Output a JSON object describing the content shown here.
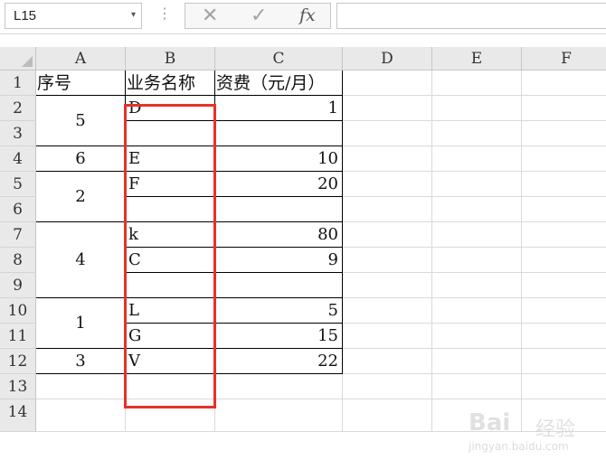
{
  "formula_bar": {
    "name_box": "L15",
    "name_box_arrow": "▾",
    "dots": "⋮",
    "cancel_icon": "✕",
    "enter_icon": "✓",
    "fx_label": "fx",
    "formula_value": ""
  },
  "columns": [
    "A",
    "B",
    "C",
    "D",
    "E",
    "F"
  ],
  "rows": [
    "1",
    "2",
    "3",
    "4",
    "5",
    "6",
    "7",
    "8",
    "9",
    "10",
    "11",
    "12",
    "13",
    "14"
  ],
  "cells": {
    "a1": "序号",
    "b1": "业务名称",
    "c1": "资费（元/月）",
    "a2_3": "5",
    "a4": "6",
    "a5_6": "2",
    "a7_9": "4",
    "a10_11": "1",
    "a12": "3",
    "b2": "D",
    "b4": "E",
    "b5": "F",
    "b7": "k",
    "b8": "C",
    "b10": "L",
    "b11": "G",
    "b12": "V",
    "c2": "1",
    "c4": "10",
    "c5": "20",
    "c7": "80",
    "c8": "9",
    "c10": "5",
    "c11": "15",
    "c12": "22"
  },
  "highlight_color": "#e8302a",
  "watermark": {
    "brand": "Bai",
    "suffix": "经验",
    "url": "jingyan.baidu.com"
  }
}
